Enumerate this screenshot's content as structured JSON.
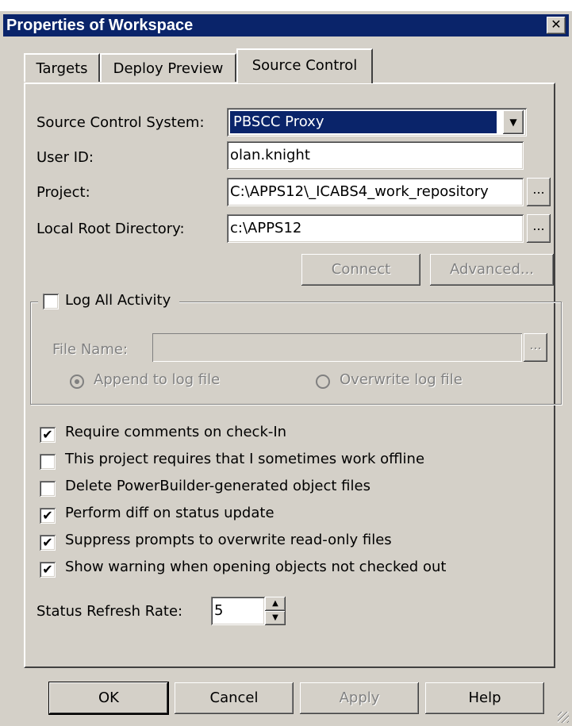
{
  "window": {
    "title": "Properties of Workspace",
    "close_glyph": "✕"
  },
  "tabs": [
    {
      "label": "Targets"
    },
    {
      "label": "Deploy Preview"
    },
    {
      "label": "Source Control"
    }
  ],
  "source_control": {
    "system_label": "Source Control System:",
    "system_value": "PBSCC Proxy",
    "userid_label": "User ID:",
    "userid_value": "olan.knight",
    "project_label": "Project:",
    "project_value": "C:\\APPS12\\_ICABS4_work_repository",
    "localroot_label": "Local Root Directory:",
    "localroot_value": "c:\\APPS12",
    "browse_label": "...",
    "connect_label": "Connect",
    "advanced_label": "Advanced..."
  },
  "log_activity": {
    "label": "Log All Activity",
    "checked": false,
    "filename_label": "File Name:",
    "filename_value": "",
    "append_label": "Append to log file",
    "overwrite_label": "Overwrite log file"
  },
  "options": [
    {
      "label": "Require comments on check-In",
      "checked": true
    },
    {
      "label": "This project requires that I sometimes work offline",
      "checked": false
    },
    {
      "label": "Delete PowerBuilder-generated object files",
      "checked": false
    },
    {
      "label": "Perform diff on status update",
      "checked": true
    },
    {
      "label": "Suppress prompts to overwrite read-only files",
      "checked": true
    },
    {
      "label": "Show warning when opening objects not checked out",
      "checked": true
    }
  ],
  "refresh": {
    "label": "Status Refresh Rate:",
    "value": "5"
  },
  "buttons": {
    "ok": "OK",
    "cancel": "Cancel",
    "apply": "Apply",
    "help": "Help"
  },
  "icons": {
    "check": "✔",
    "dropdown": "▼",
    "spin_up": "▲",
    "spin_down": "▼"
  }
}
